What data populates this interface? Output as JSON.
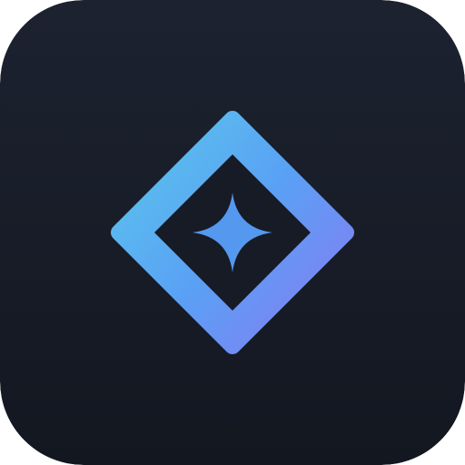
{
  "icon": {
    "name": "diamond-sparkle-app-icon",
    "emblem": "diamond-outline-with-four-point-star",
    "colors": {
      "background_top": "#1c2230",
      "background_bottom": "#131720",
      "gradient_start": "#5bc7ea",
      "gradient_mid": "#5aa0f5",
      "gradient_end": "#8a78f2",
      "star": "#5598f0"
    }
  }
}
